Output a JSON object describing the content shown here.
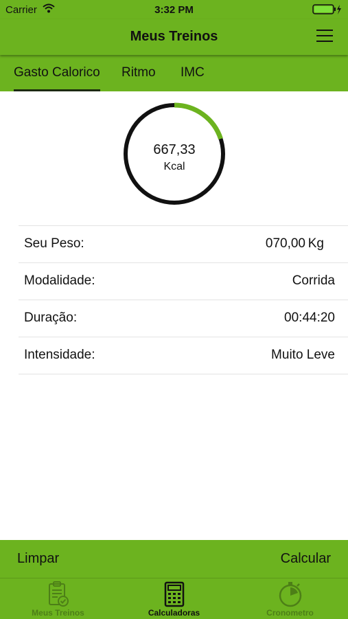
{
  "status_bar": {
    "carrier": "Carrier",
    "time": "3:32 PM"
  },
  "nav": {
    "title": "Meus Treinos",
    "menu_icon": "hamburger-menu-icon"
  },
  "tabs": [
    {
      "label": "Gasto Calorico",
      "active": true
    },
    {
      "label": "Ritmo",
      "active": false
    },
    {
      "label": "IMC",
      "active": false
    }
  ],
  "gauge": {
    "value": "667,33",
    "unit": "Kcal",
    "progress": 0.2
  },
  "form": {
    "weight": {
      "label": "Seu Peso:",
      "value": "070,00",
      "unit": "Kg"
    },
    "modality": {
      "label": "Modalidade:",
      "value": "Corrida"
    },
    "duration": {
      "label": "Duração:",
      "value": "00:44:20"
    },
    "intensity": {
      "label": "Intensidade:",
      "value": "Muito Leve"
    }
  },
  "actions": {
    "clear_label": "Limpar",
    "calculate_label": "Calcular"
  },
  "tab_bar": {
    "items": [
      {
        "label": "Meus Treinos",
        "icon": "clipboard-check-icon",
        "selected": false
      },
      {
        "label": "Calculadoras",
        "icon": "calculator-icon",
        "selected": true
      },
      {
        "label": "Cronometro",
        "icon": "stopwatch-icon",
        "selected": false
      }
    ]
  },
  "colors": {
    "primary": "#6cb31f",
    "gauge_ring": "#111111",
    "gauge_progress": "#6cb31f"
  }
}
